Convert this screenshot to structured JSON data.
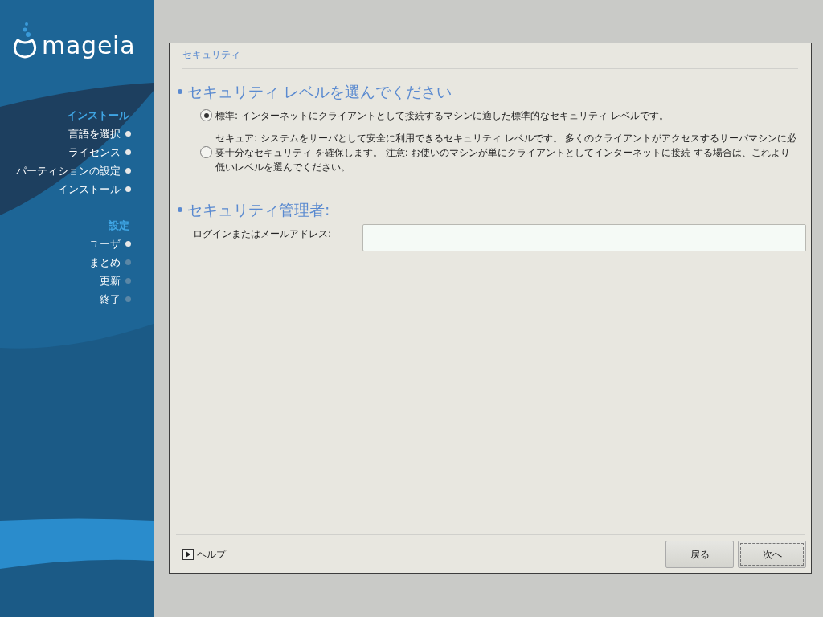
{
  "logo": {
    "text": "mageia"
  },
  "sidebar": {
    "sections": [
      {
        "title": "インストール",
        "steps": [
          {
            "label": "言語を選択",
            "done": true
          },
          {
            "label": "ライセンス",
            "done": true
          },
          {
            "label": "パーティションの設定",
            "done": true
          },
          {
            "label": "インストール",
            "done": true
          }
        ]
      },
      {
        "title": "設定",
        "steps": [
          {
            "label": "ユーザ",
            "done": true
          },
          {
            "label": "まとめ",
            "done": false
          },
          {
            "label": "更新",
            "done": false
          },
          {
            "label": "終了",
            "done": false
          }
        ]
      }
    ]
  },
  "panel": {
    "title": "セキュリティ",
    "level_section": {
      "heading": "セキュリティ レベルを選んでください",
      "options": [
        {
          "label": "標準: インターネットにクライアントとして接続するマシンに適した標準的なセキュリティ レベルです。",
          "selected": true
        },
        {
          "label": "セキュア: システムをサーバとして安全に利用できるセキュリティ レベルです。 多くのクライアントがアクセスするサーバマシンに必要十分なセキュリティ を確保します。 注意: お使いのマシンが単にクライアントとしてインターネットに接続 する場合は、これより低いレベルを選んでください。",
          "selected": false
        }
      ]
    },
    "admin_section": {
      "heading": "セキュリティ管理者:",
      "field_label": "ログインまたはメールアドレス:"
    },
    "help": "ヘルプ",
    "buttons": [
      {
        "label": "戻る",
        "focused": false
      },
      {
        "label": "次へ",
        "focused": true
      }
    ]
  }
}
